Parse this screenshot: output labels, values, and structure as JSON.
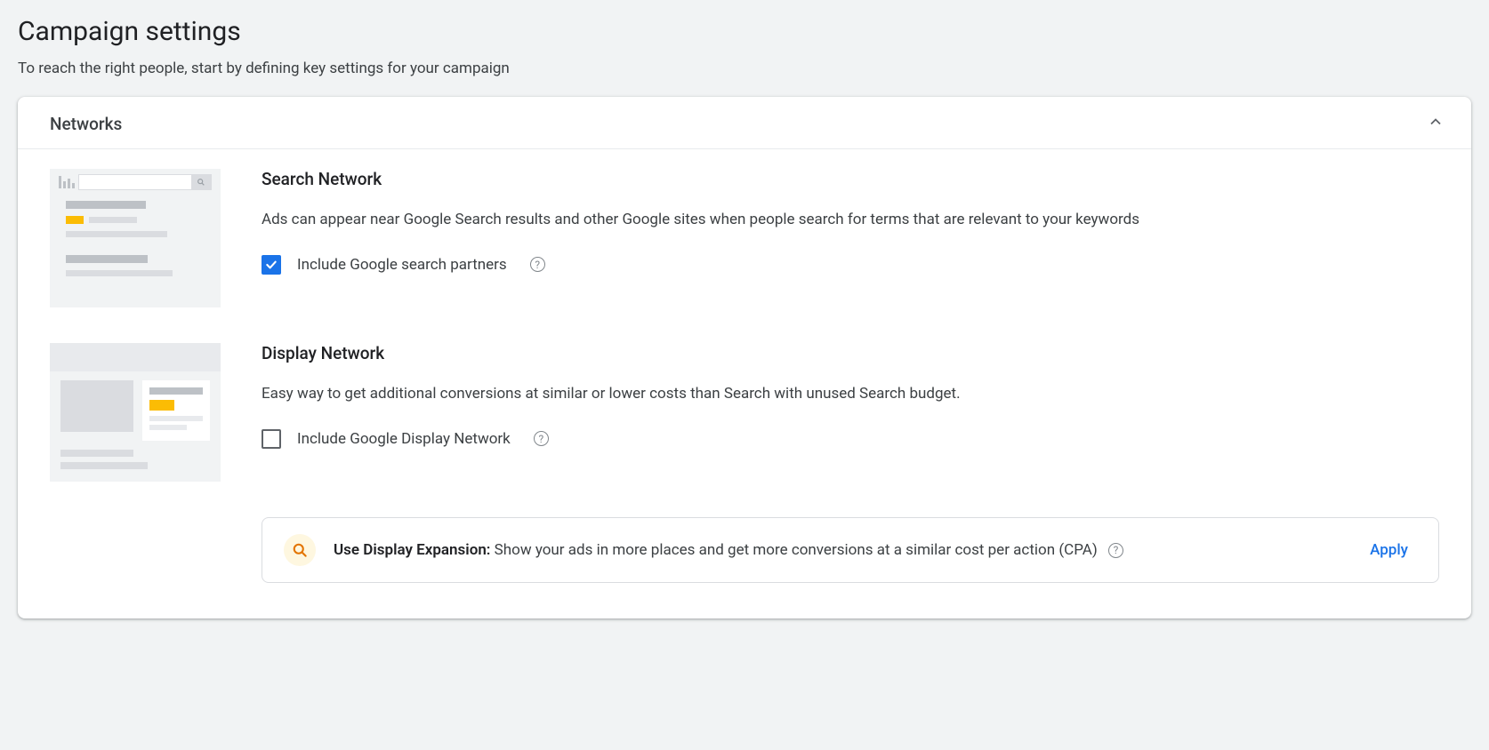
{
  "page": {
    "title": "Campaign settings",
    "subtitle": "To reach the right people, start by defining key settings for your campaign"
  },
  "networks": {
    "section_title": "Networks",
    "search": {
      "title": "Search Network",
      "description": "Ads can appear near Google Search results and other Google sites when people search for terms that are relevant to your keywords",
      "checkbox_label": "Include Google search partners",
      "checked": true
    },
    "display": {
      "title": "Display Network",
      "description": "Easy way to get additional conversions at similar or lower costs than Search with unused Search budget.",
      "checkbox_label": "Include Google Display Network",
      "checked": false
    }
  },
  "recommendation": {
    "bold": "Use Display Expansion:",
    "text": " Show your ads in more places and get more conversions at a similar cost per action (CPA) ",
    "apply_label": "Apply"
  }
}
